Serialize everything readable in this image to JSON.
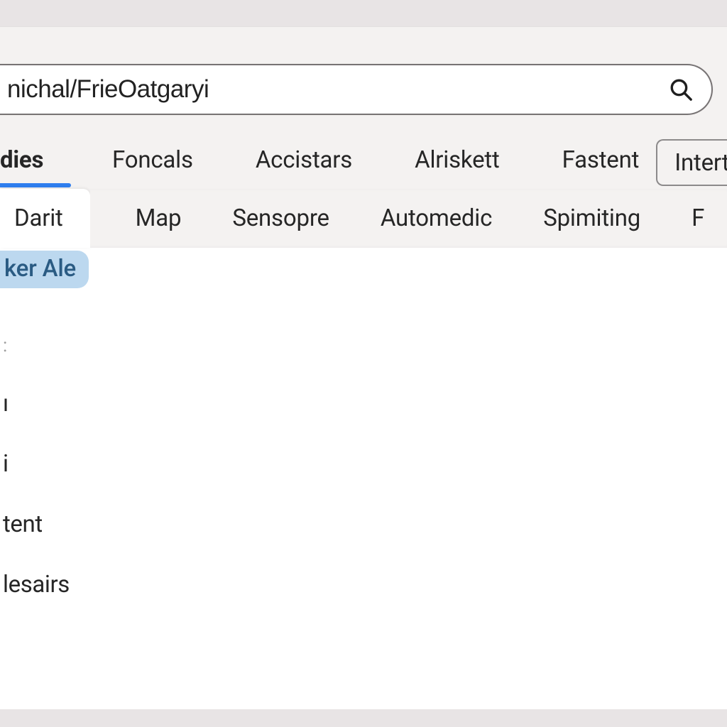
{
  "search": {
    "value": "nichal/FrieOatgaryi"
  },
  "tabs": {
    "primary": [
      {
        "label": "dies",
        "active": true
      },
      {
        "label": "Foncals",
        "active": false
      },
      {
        "label": "Accistars",
        "active": false
      },
      {
        "label": "Alriskett",
        "active": false
      },
      {
        "label": "Fastent",
        "active": false
      }
    ],
    "action_button": "Intert",
    "secondary": [
      {
        "label": "Darit",
        "active": true
      },
      {
        "label": "Map",
        "active": false
      },
      {
        "label": "Sensopre",
        "active": false
      },
      {
        "label": "Automedic",
        "active": false
      },
      {
        "label": "Spimiting",
        "active": false
      },
      {
        "label": "F",
        "active": false
      }
    ]
  },
  "highlight": "ker Ale",
  "sidebar": {
    "items": [
      ":",
      "ı",
      "i",
      "tent",
      "lesairs"
    ]
  }
}
